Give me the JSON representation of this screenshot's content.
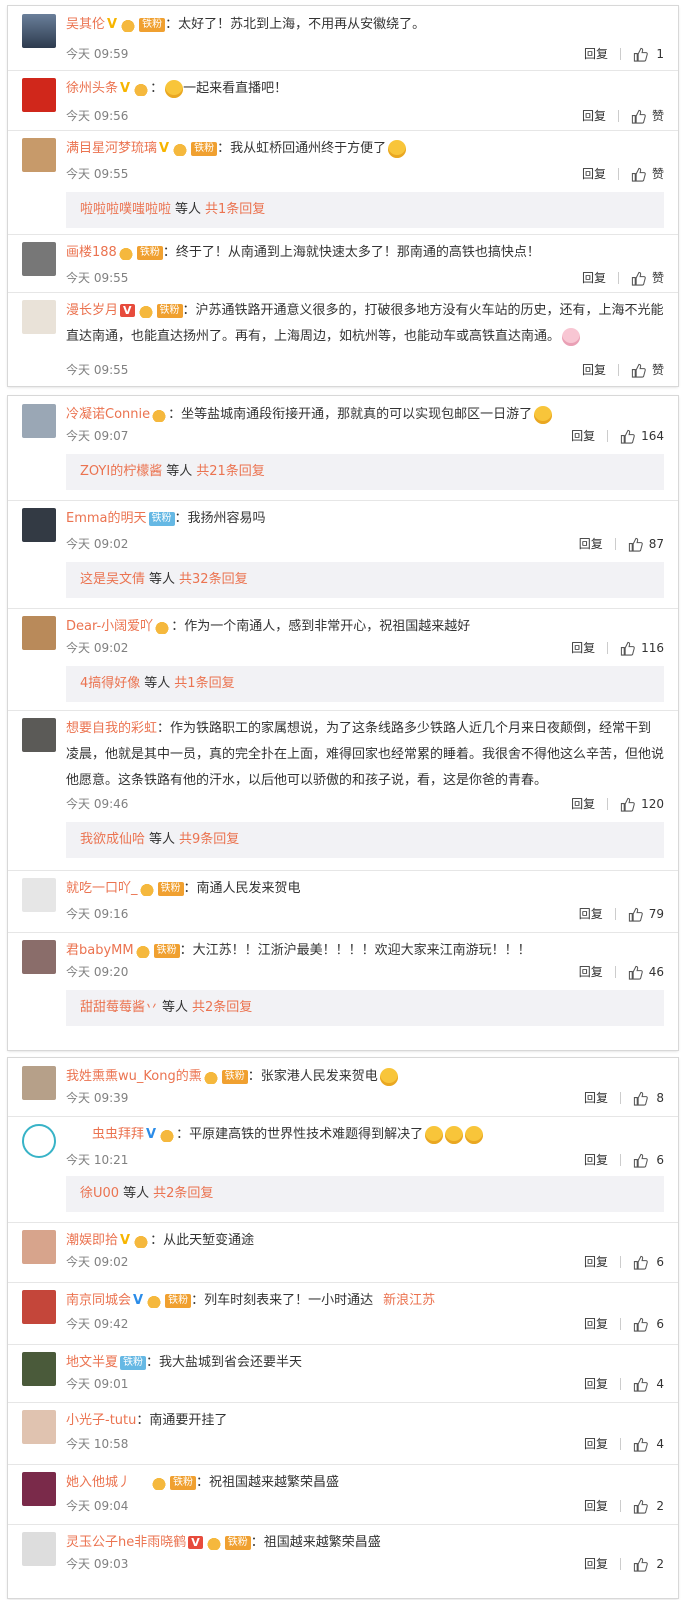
{
  "ui": {
    "reply_label": "回复",
    "thumb_icon": "thumbs-up-icon",
    "accent": "#eb7350"
  },
  "panel1": [
    {
      "user": "吴其伦",
      "badge": "V",
      "colon": "：",
      "text": "太好了！苏北到上海，不用再从安徽绕了。",
      "time": "今天 09:59",
      "likes": "1"
    },
    {
      "user": "徐州头条",
      "badge": "V",
      "colon": "：",
      "text": "一起来看直播吧！",
      "time": "今天 09:56",
      "likes": "赞"
    },
    {
      "user": "满目星河梦琉璃",
      "badge": "V",
      "fan": "铁粉",
      "colon": "：",
      "text": "我从虹桥回通州终于方便了",
      "time": "今天 09:55",
      "likes": "赞",
      "sub": {
        "who": "啦啦啦噗嗤啦啦",
        "mid": "等人",
        "count": "共1条回复"
      }
    },
    {
      "user": "画楼188",
      "fan": "铁粉",
      "colon": "：",
      "text": "终于了！从南通到上海就快速太多了！那南通的高铁也搞快点！",
      "time": "今天 09:55",
      "likes": "赞"
    },
    {
      "user": "漫长岁月",
      "badge": "V",
      "fan": "铁粉",
      "colon": "：",
      "text": "沪苏通铁路开通意义很多的，打破很多地方没有火车站的历史，还有，上海不光能直达南通，也能直达扬州了。再有，上海周边，如杭州等，也能动车或高铁直达南通。",
      "time": "今天 09:55",
      "likes": "赞"
    }
  ],
  "panel2": [
    {
      "user": "冷凝诺Connie",
      "colon": "：",
      "text": "坐等盐城南通段衔接开通，那就真的可以实现包邮区一日游了",
      "time": "今天 09:07",
      "likes": "164",
      "sub": {
        "who": "ZOYI的柠檬酱",
        "mid": "等人",
        "count": "共21条回复"
      }
    },
    {
      "user": "Emma的明天",
      "fan": "铁粉",
      "colon": "：",
      "text": "我扬州容易吗",
      "time": "今天 09:02",
      "likes": "87",
      "sub": {
        "who": "这是吴文倩",
        "mid": "等人",
        "count": "共32条回复"
      }
    },
    {
      "user": "Dear-小阔爱吖",
      "colon": "：",
      "text": "作为一个南通人，感到非常开心，祝祖国越来越好",
      "time": "今天 09:02",
      "likes": "116",
      "sub": {
        "who": "4搞得好像",
        "mid": "等人",
        "count": "共1条回复"
      }
    },
    {
      "user": "想要自我的彩虹",
      "colon": "：",
      "text": "作为铁路职工的家属想说，为了这条线路多少铁路人近几个月来日夜颠倒，经常干到凌晨，他就是其中一员，真的完全扑在上面，难得回家也经常累的睡着。我很舍不得他这么辛苦，但他说他愿意。这条铁路有他的汗水，以后他可以骄傲的和孩子说，看，这是你爸的青春。",
      "time": "今天 09:46",
      "likes": "120",
      "sub": {
        "who": "我欲成仙哈",
        "mid": "等人",
        "count": "共9条回复"
      }
    },
    {
      "user": "就吃一口吖_",
      "fan": "铁粉",
      "colon": "：",
      "text": "南通人民发来贺电",
      "time": "今天 09:16",
      "likes": "79"
    },
    {
      "user": "君babyMM",
      "fan": "铁粉",
      "colon": "：",
      "text": "大江苏！！江浙沪最美！！！！欢迎大家来江南游玩！！！",
      "time": "今天 09:20",
      "likes": "46",
      "sub": {
        "who": "甜甜莓莓酱丷",
        "mid": "等人",
        "count": "共2条回复"
      }
    }
  ],
  "panel3": [
    {
      "user": "我姓熏熏wu_Kong的熏",
      "fan": "铁粉",
      "colon": "：",
      "text": "张家港人民发来贺电",
      "time": "今天 09:39",
      "likes": "8"
    },
    {
      "user": "虫虫拜拜",
      "badge": "V",
      "colon": "：",
      "text": "平原建高铁的世界性技术难题得到解决了",
      "time": "今天 10:21",
      "likes": "6",
      "sub": {
        "who": "徐U00",
        "mid": "等人",
        "count": "共2条回复"
      }
    },
    {
      "user": "潮娱即拾",
      "badge": "V",
      "colon": "：",
      "text": "从此天堑变通途",
      "time": "今天 09:02",
      "likes": "6"
    },
    {
      "user": "南京同城会",
      "badge": "V",
      "fan": "铁粉",
      "colon": "：",
      "text": "列车时刻表来了！一小时通达",
      "source": "新浪江苏",
      "time": "今天 09:42",
      "likes": "6"
    },
    {
      "user": "地文半夏",
      "fan": "铁粉",
      "colon": "：",
      "text": "我大盐城到省会还要半天",
      "time": "今天 09:01",
      "likes": "4"
    },
    {
      "user": "小光子-tutu",
      "colon": "：",
      "text": "南通要开挂了",
      "time": "今天 10:58",
      "likes": "4"
    },
    {
      "user": "她入他城丿",
      "fan": "铁粉",
      "colon": "：",
      "text": "祝祖国越来越繁荣昌盛",
      "time": "今天 09:04",
      "likes": "2"
    },
    {
      "user": "灵玉公子he非雨晓鹤",
      "badge": "V",
      "fan": "铁粉",
      "colon": "：",
      "text": "祖国越来越繁荣昌盛",
      "time": "今天 09:03",
      "likes": "2"
    }
  ]
}
